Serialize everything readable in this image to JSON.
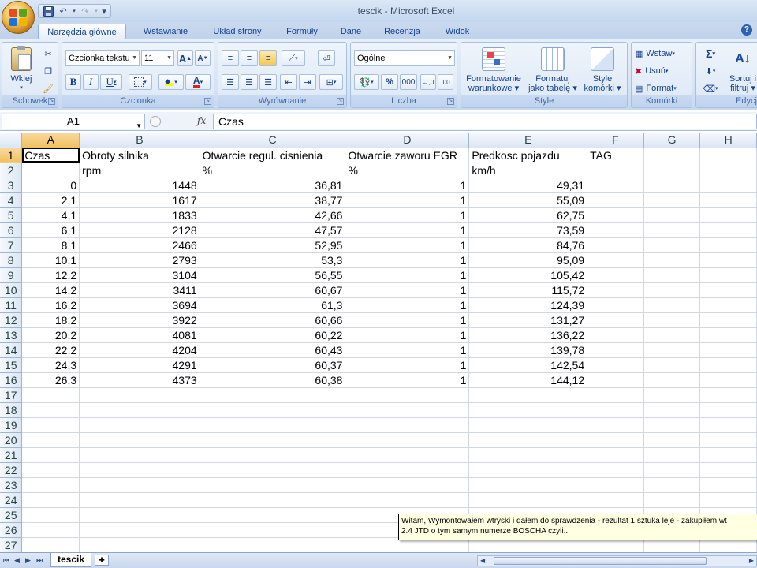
{
  "window": {
    "title": "tescik - Microsoft Excel"
  },
  "qat": {
    "save": "save-icon",
    "undo": "↶",
    "redo": "↷",
    "customize": "▾"
  },
  "tabs": [
    "Narzędzia główne",
    "Wstawianie",
    "Układ strony",
    "Formuły",
    "Dane",
    "Recenzja",
    "Widok"
  ],
  "ribbon": {
    "clipboard": {
      "paste": "Wklej",
      "label": "Schowek"
    },
    "font": {
      "name": "Czcionka tekstu",
      "size": "11",
      "grow": "A",
      "shrink": "A",
      "bold": "B",
      "italic": "I",
      "underline": "U",
      "fontcolor": "A",
      "label": "Czcionka"
    },
    "alignment": {
      "label": "Wyrównanie"
    },
    "number": {
      "format": "Ogólne",
      "percent": "%",
      "thousands": "000",
      "label": "Liczba"
    },
    "styles": {
      "conditional": "Formatowanie",
      "conditional2": "warunkowe",
      "table": "Formatuj",
      "table2": "jako tabelę",
      "cell": "Style",
      "cell2": "komórki",
      "label": "Style"
    },
    "cells": {
      "insert": "Wstaw",
      "delete": "Usuń",
      "format": "Format",
      "label": "Komórki"
    },
    "editing": {
      "sort": "Sortuj i",
      "sort2": "filtruj",
      "label": "Edycja"
    }
  },
  "formula_bar": {
    "name_box": "A1",
    "fx": "fx",
    "formula": "Czas"
  },
  "columns": [
    "A",
    "B",
    "C",
    "D",
    "E",
    "F",
    "G",
    "H"
  ],
  "rows": [
    [
      "Czas",
      "Obroty silnika",
      "Otwarcie regul. cisnienia",
      "Otwarcie zaworu EGR",
      "Predkosc pojazdu",
      "TAG",
      "",
      ""
    ],
    [
      "",
      "rpm",
      "%",
      "%",
      "km/h",
      "",
      "",
      ""
    ],
    [
      "0",
      "1448",
      "36,81",
      "1",
      "49,31",
      "",
      "",
      ""
    ],
    [
      "2,1",
      "1617",
      "38,77",
      "1",
      "55,09",
      "",
      "",
      ""
    ],
    [
      "4,1",
      "1833",
      "42,66",
      "1",
      "62,75",
      "",
      "",
      ""
    ],
    [
      "6,1",
      "2128",
      "47,57",
      "1",
      "73,59",
      "",
      "",
      ""
    ],
    [
      "8,1",
      "2466",
      "52,95",
      "1",
      "84,76",
      "",
      "",
      ""
    ],
    [
      "10,1",
      "2793",
      "53,3",
      "1",
      "95,09",
      "",
      "",
      ""
    ],
    [
      "12,2",
      "3104",
      "56,55",
      "1",
      "105,42",
      "",
      "",
      ""
    ],
    [
      "14,2",
      "3411",
      "60,67",
      "1",
      "115,72",
      "",
      "",
      ""
    ],
    [
      "16,2",
      "3694",
      "61,3",
      "1",
      "124,39",
      "",
      "",
      ""
    ],
    [
      "18,2",
      "3922",
      "60,66",
      "1",
      "131,27",
      "",
      "",
      ""
    ],
    [
      "20,2",
      "4081",
      "60,22",
      "1",
      "136,22",
      "",
      "",
      ""
    ],
    [
      "22,2",
      "4204",
      "60,43",
      "1",
      "139,78",
      "",
      "",
      ""
    ],
    [
      "24,3",
      "4291",
      "60,37",
      "1",
      "142,54",
      "",
      "",
      ""
    ],
    [
      "26,3",
      "4373",
      "60,38",
      "1",
      "144,12",
      "",
      "",
      ""
    ],
    [
      "",
      "",
      "",
      "",
      "",
      "",
      "",
      ""
    ],
    [
      "",
      "",
      "",
      "",
      "",
      "",
      "",
      ""
    ],
    [
      "",
      "",
      "",
      "",
      "",
      "",
      "",
      ""
    ],
    [
      "",
      "",
      "",
      "",
      "",
      "",
      "",
      ""
    ],
    [
      "",
      "",
      "",
      "",
      "",
      "",
      "",
      ""
    ],
    [
      "",
      "",
      "",
      "",
      "",
      "",
      "",
      ""
    ],
    [
      "",
      "",
      "",
      "",
      "",
      "",
      "",
      ""
    ],
    [
      "",
      "",
      "",
      "",
      "",
      "",
      "",
      ""
    ],
    [
      "",
      "",
      "",
      "",
      "",
      "",
      "",
      ""
    ],
    [
      "",
      "",
      "",
      "",
      "",
      "",
      "",
      ""
    ],
    [
      "",
      "",
      "",
      "",
      "",
      "",
      "",
      ""
    ]
  ],
  "comment": {
    "line1": "Witam,  Wymontowałem wtryski i dałem do sprawdzenia - rezultat 1 sztuka leje - zakupiłem wt",
    "line2": "2.4 JTD o tym samym numerze BOSCHA czyli..."
  },
  "sheets": {
    "active": "tescik"
  }
}
